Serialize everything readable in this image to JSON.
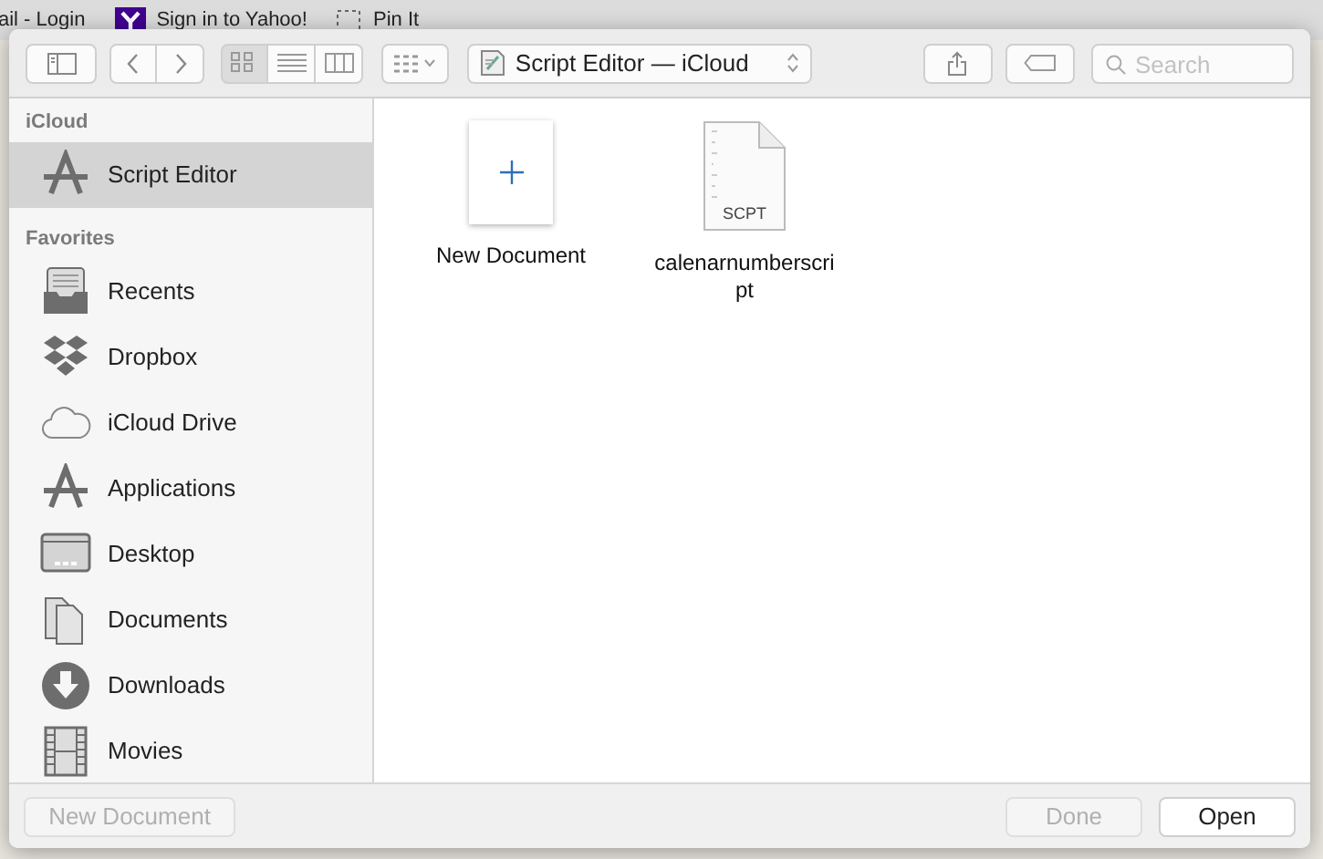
{
  "bookmarks": [
    {
      "label": "ail - Login",
      "kind": "plain"
    },
    {
      "label": "Sign in to Yahoo!",
      "kind": "yahoo"
    },
    {
      "label": "Pin It",
      "kind": "pin"
    }
  ],
  "toolbar": {
    "view_modes": [
      {
        "kind": "icons",
        "selected": true
      },
      {
        "kind": "list",
        "selected": false
      },
      {
        "kind": "columns",
        "selected": false
      }
    ],
    "location": "Script Editor — iCloud",
    "search": {
      "placeholder": "Search"
    }
  },
  "sidebar": [
    {
      "heading": "iCloud",
      "items": [
        {
          "label": "Script Editor",
          "kind": "apps",
          "selected": true
        }
      ]
    },
    {
      "heading": "Favorites",
      "items": [
        {
          "label": "Recents",
          "kind": "recents",
          "selected": false
        },
        {
          "label": "Dropbox",
          "kind": "dropbox",
          "selected": false
        },
        {
          "label": "iCloud Drive",
          "kind": "cloud",
          "selected": false
        },
        {
          "label": "Applications",
          "kind": "apps",
          "selected": false
        },
        {
          "label": "Desktop",
          "kind": "desktop",
          "selected": false
        },
        {
          "label": "Documents",
          "kind": "documents",
          "selected": false
        },
        {
          "label": "Downloads",
          "kind": "downloads",
          "selected": false
        },
        {
          "label": "Movies",
          "kind": "movies",
          "selected": false
        }
      ]
    }
  ],
  "files": [
    {
      "name": "New Document",
      "kind": "new"
    },
    {
      "name": "calenarnumberscript",
      "kind": "script",
      "badge": "SCPT"
    }
  ],
  "left_buttons": [
    {
      "label": "New Document",
      "disabled": true
    }
  ],
  "right_buttons": [
    {
      "label": "Done",
      "disabled": true
    },
    {
      "label": "Open",
      "disabled": false
    }
  ]
}
